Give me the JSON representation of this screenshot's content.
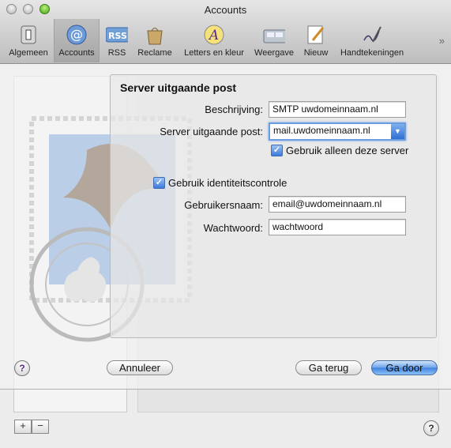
{
  "window": {
    "title": "Accounts"
  },
  "toolbar": {
    "items": [
      {
        "label": "Algemeen",
        "icon": "switch-icon"
      },
      {
        "label": "Accounts",
        "icon": "at-icon"
      },
      {
        "label": "RSS",
        "icon": "rss-icon"
      },
      {
        "label": "Reclame",
        "icon": "trash-bag-icon"
      },
      {
        "label": "Letters en kleur",
        "icon": "font-color-icon"
      },
      {
        "label": "Weergave",
        "icon": "view-icon"
      },
      {
        "label": "Nieuw",
        "icon": "compose-icon"
      },
      {
        "label": "Handtekeningen",
        "icon": "signature-icon"
      }
    ],
    "selected": "Accounts",
    "more_glyph": "»"
  },
  "sheet": {
    "section_title": "Server uitgaande post",
    "description_label": "Beschrijving:",
    "description_value": "SMTP uwdomeinnaam.nl",
    "server_label": "Server uitgaande post:",
    "server_value": "mail.uwdomeinnaam.nl",
    "only_this_server_label": "Gebruik alleen deze server",
    "only_this_server_checked": true,
    "use_auth_label": "Gebruik identiteitscontrole",
    "use_auth_checked": true,
    "username_label": "Gebruikersnaam:",
    "username_value": "email@uwdomeinnaam.nl",
    "password_label": "Wachtwoord:",
    "password_value": "wachtwoord",
    "cancel_label": "Annuleer",
    "back_label": "Ga terug",
    "continue_label": "Ga door",
    "help_glyph": "?"
  },
  "footer": {
    "add_glyph": "+",
    "remove_glyph": "−",
    "help_glyph": "?"
  },
  "colors": {
    "accent": "#3f83e0",
    "focus": "#6c9ce0"
  }
}
